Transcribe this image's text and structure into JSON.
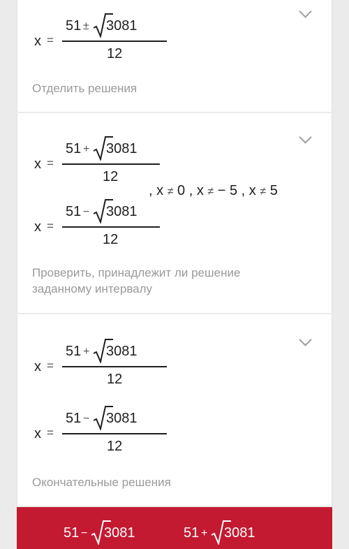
{
  "step1": {
    "x_label": "x",
    "equals": "=",
    "numerator_a": "51",
    "operator": "±",
    "radicand": "3081",
    "denominator": "12",
    "caption": "Отделить решения"
  },
  "step2": {
    "eq1": {
      "x_label": "x",
      "equals": "=",
      "numerator_a": "51",
      "operator": "+",
      "radicand": "3081",
      "denominator": "12"
    },
    "eq2": {
      "x_label": "x",
      "equals": "=",
      "numerator_a": "51",
      "operator": "−",
      "radicand": "3081",
      "denominator": "12"
    },
    "conditions": [
      {
        "sep": ",",
        "x": "x",
        "ne": "≠",
        "value": "0"
      },
      {
        "sep": ",",
        "x": "x",
        "ne": "≠",
        "value": "− 5"
      },
      {
        "sep": ",",
        "x": "x",
        "ne": "≠",
        "value": "5"
      }
    ],
    "caption_line1": "Проверить, принадлежит ли решение",
    "caption_line2": "заданному интервалу"
  },
  "step3": {
    "eq1": {
      "x_label": "x",
      "equals": "=",
      "numerator_a": "51",
      "operator": "+",
      "radicand": "3081",
      "denominator": "12"
    },
    "eq2": {
      "x_label": "x",
      "equals": "=",
      "numerator_a": "51",
      "operator": "−",
      "radicand": "3081",
      "denominator": "12"
    },
    "caption": "Окончательные решения"
  },
  "final": {
    "left": {
      "numerator_a": "51",
      "operator": "−",
      "radicand": "3081"
    },
    "right": {
      "numerator_a": "51",
      "operator": "+",
      "radicand": "3081"
    }
  },
  "colors": {
    "accent": "#c31a32",
    "caption": "#9a9a9a",
    "background": "#ebebeb"
  },
  "icons": {
    "expand": "chevron-down-icon"
  }
}
